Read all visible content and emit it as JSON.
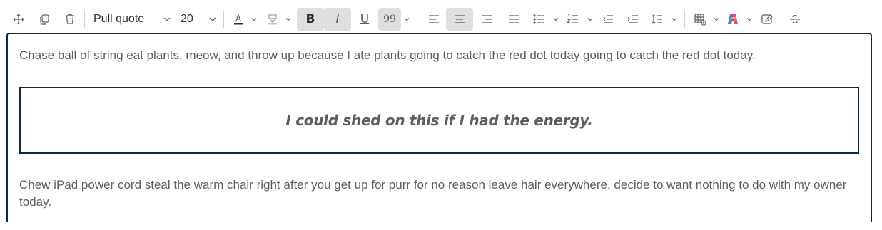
{
  "toolbar": {
    "style_value": "Pull quote",
    "font_size_value": "20",
    "bold_label": "B",
    "italic_label": "I",
    "underline_label": "U",
    "quote_label": "99"
  },
  "editor": {
    "paragraph_1": "Chase ball of string eat plants, meow, and throw up because I ate plants going to catch the red dot today going to catch the red dot today.",
    "pull_quote": "I could shed on this if I had the energy.",
    "paragraph_2": "Chew iPad power cord steal the warm chair right after you get up for purr for no reason leave hair everywhere, decide to want nothing to do with my owner today."
  },
  "colors": {
    "accent_border": "#0b2b45",
    "active_button_bg": "#e1dfdd",
    "text": "#605e5c"
  }
}
